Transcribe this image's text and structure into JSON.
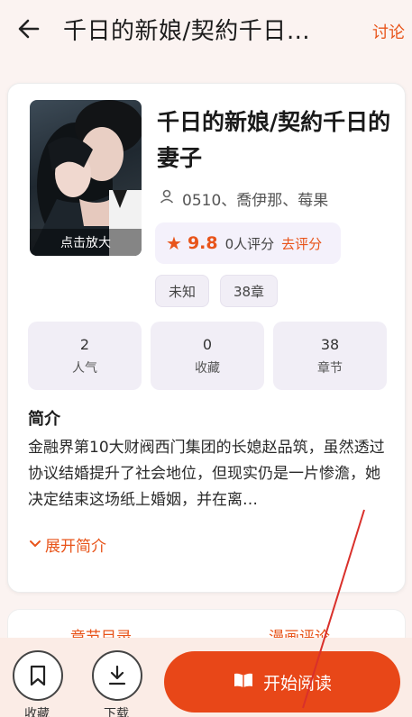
{
  "header": {
    "title": "千日的新娘/契約千日的妻子",
    "discuss_label": "讨论"
  },
  "book": {
    "cover_label": "点击放大",
    "title": "千日的新娘/契約千日的妻子",
    "authors": "0510、喬伊那、莓果",
    "rating": {
      "score": "9.8",
      "count": "0人评分",
      "rate_link": "去评分"
    },
    "tags": [
      "未知",
      "38章"
    ],
    "stats": [
      {
        "value": "2",
        "label": "人气"
      },
      {
        "value": "0",
        "label": "收藏"
      },
      {
        "value": "38",
        "label": "章节"
      }
    ],
    "intro_heading": "简介",
    "intro_text": "金融界第10大财阀西门集团的长媳赵品筑，虽然透过协议结婚提升了社会地位，但现实仍是一片惨澹，她决定结束这场纸上婚姻，并在离…",
    "expand_label": "展开简介"
  },
  "tabs": [
    "章节目录",
    "漫画评论"
  ],
  "bottom": {
    "favorite_label": "收藏",
    "download_label": "下载",
    "read_label": "开始阅读"
  },
  "colors": {
    "accent": "#e84718",
    "link": "#e8541a"
  }
}
